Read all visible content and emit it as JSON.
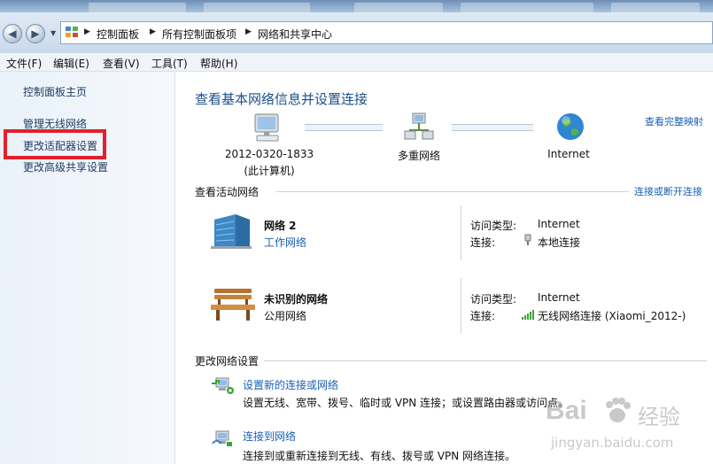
{
  "address": {
    "crumbs": [
      "控制面板",
      "所有控制面板项",
      "网络和共享中心"
    ]
  },
  "menu": [
    "文件(F)",
    "编辑(E)",
    "查看(V)",
    "工具(T)",
    "帮助(H)"
  ],
  "sidebar": {
    "items": [
      "控制面板主页",
      "管理无线网络",
      "更改适配器设置",
      "更改高级共享设置"
    ]
  },
  "main": {
    "title": "查看基本网络信息并设置连接",
    "full_map_link": "查看完整映射",
    "map": {
      "computer_name": "2012-0320-1833",
      "computer_note": "(此计算机)",
      "middle": "多重网络",
      "internet": "Internet"
    },
    "active": {
      "label": "查看活动网络",
      "connect_link": "连接或断开连接",
      "networks": [
        {
          "name": "网络  2",
          "type": "工作网络",
          "access_key": "访问类型:",
          "access_value": "Internet",
          "conn_key": "连接:",
          "conn_value": "本地连接"
        },
        {
          "name": "未识别的网络",
          "type": "公用网络",
          "access_key": "访问类型:",
          "access_value": "Internet",
          "conn_key": "连接:",
          "conn_value": "无线网络连接 (Xiaomi_2012-)"
        }
      ]
    },
    "change": {
      "label": "更改网络设置",
      "tasks": [
        {
          "title": "设置新的连接或网络",
          "desc": "设置无线、宽带、拨号、临时或 VPN 连接；或设置路由器或访问点。"
        },
        {
          "title": "连接到网络",
          "desc": "连接到或重新连接到无线、有线、拨号或 VPN 网络连接。"
        }
      ]
    }
  },
  "watermark": {
    "brand": "Bai",
    "brand_cn": "经验",
    "url": "jingyan.baidu.com"
  },
  "colors": {
    "link": "#1a5fb4",
    "title": "#1b4f8a",
    "highlight": "#e2202b"
  }
}
